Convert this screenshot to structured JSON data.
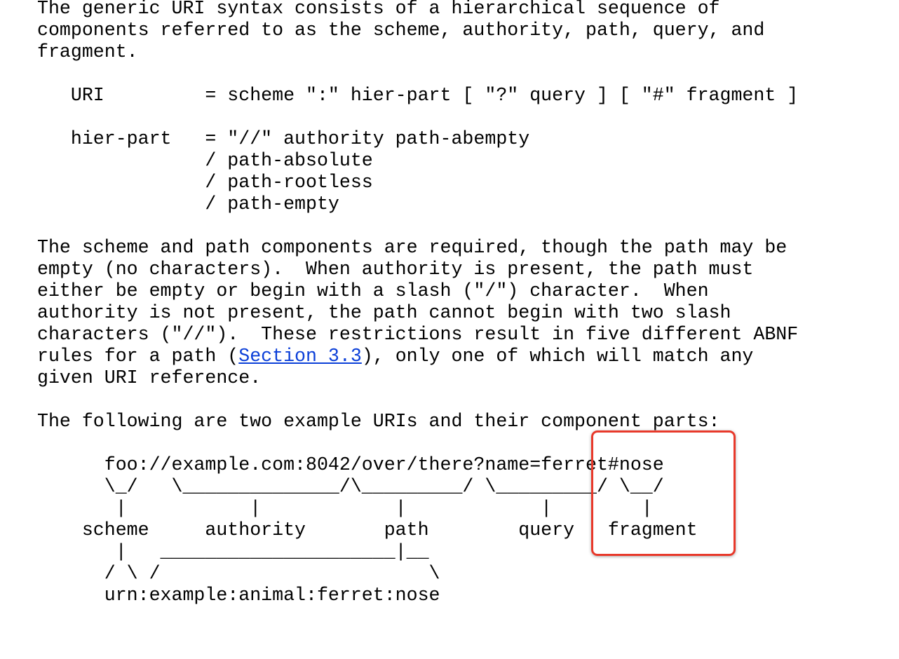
{
  "document": {
    "lines": [
      "The generic URI syntax consists of a hierarchical sequence of",
      "components referred to as the scheme, authority, path, query, and",
      "fragment.",
      "",
      "   URI         = scheme \":\" hier-part [ \"?\" query ] [ \"#\" fragment ]",
      "",
      "   hier-part   = \"//\" authority path-abempty",
      "               / path-absolute",
      "               / path-rootless",
      "               / path-empty",
      "",
      "The scheme and path components are required, though the path may be",
      "empty (no characters).  When authority is present, the path must",
      "either be empty or begin with a slash (\"/\") character.  When",
      "authority is not present, the path cannot begin with two slash",
      "characters (\"//\").  These restrictions result in five different ABNF",
      {
        "before": "rules for a path (",
        "link": "Section 3.3",
        "after": "), only one of which will match any"
      },
      "given URI reference.",
      "",
      "The following are two example URIs and their component parts:",
      "",
      "      foo://example.com:8042/over/there?name=ferret#nose",
      "      \\_/   \\______________/\\_________/ \\_________/ \\__/",
      "       |           |            |            |        |",
      "    scheme     authority       path        query   fragment",
      "       |   _____________________|__",
      "      / \\ /                        \\",
      "      urn:example:animal:ferret:nose"
    ]
  },
  "highlight": {
    "target": "fragment",
    "color": "#e8392b"
  },
  "colors": {
    "link": "#0b3fd8"
  }
}
